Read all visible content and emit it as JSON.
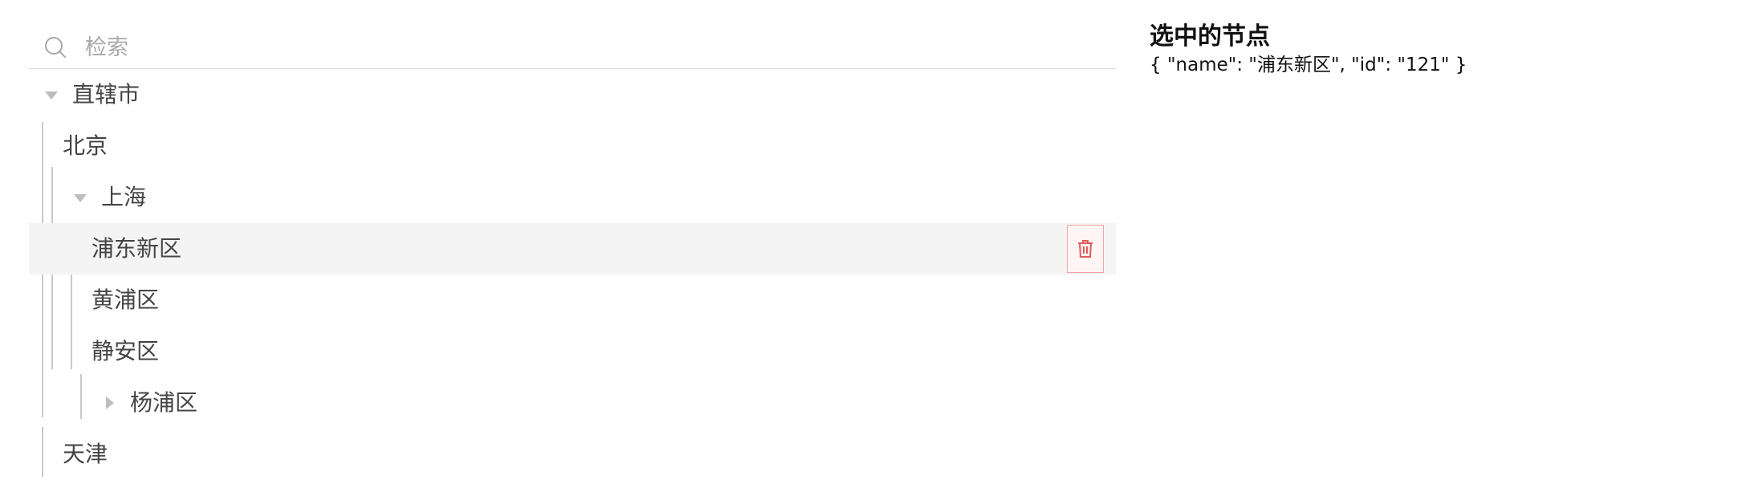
{
  "search": {
    "placeholder": "检索",
    "value": ""
  },
  "tree": {
    "nodes": [
      {
        "label": "直辖市",
        "expanded": true
      },
      {
        "label": "北京"
      },
      {
        "label": "上海",
        "expanded": true
      },
      {
        "label": "浦东新区",
        "selected": true,
        "action_icon": "trash-icon"
      },
      {
        "label": "黄浦区"
      },
      {
        "label": "静安区"
      },
      {
        "label": "杨浦区",
        "expanded": false
      },
      {
        "label": "天津"
      }
    ]
  },
  "panel": {
    "title": "选中的节点",
    "json_text": "{ \"name\": \"浦东新区\", \"id\": \"121\" }"
  },
  "colors": {
    "selected_bg": "#f4f4f4",
    "delete_border": "#f1a3a3",
    "delete_icon": "#e25a5a",
    "guide_line": "#c9c9c9"
  }
}
